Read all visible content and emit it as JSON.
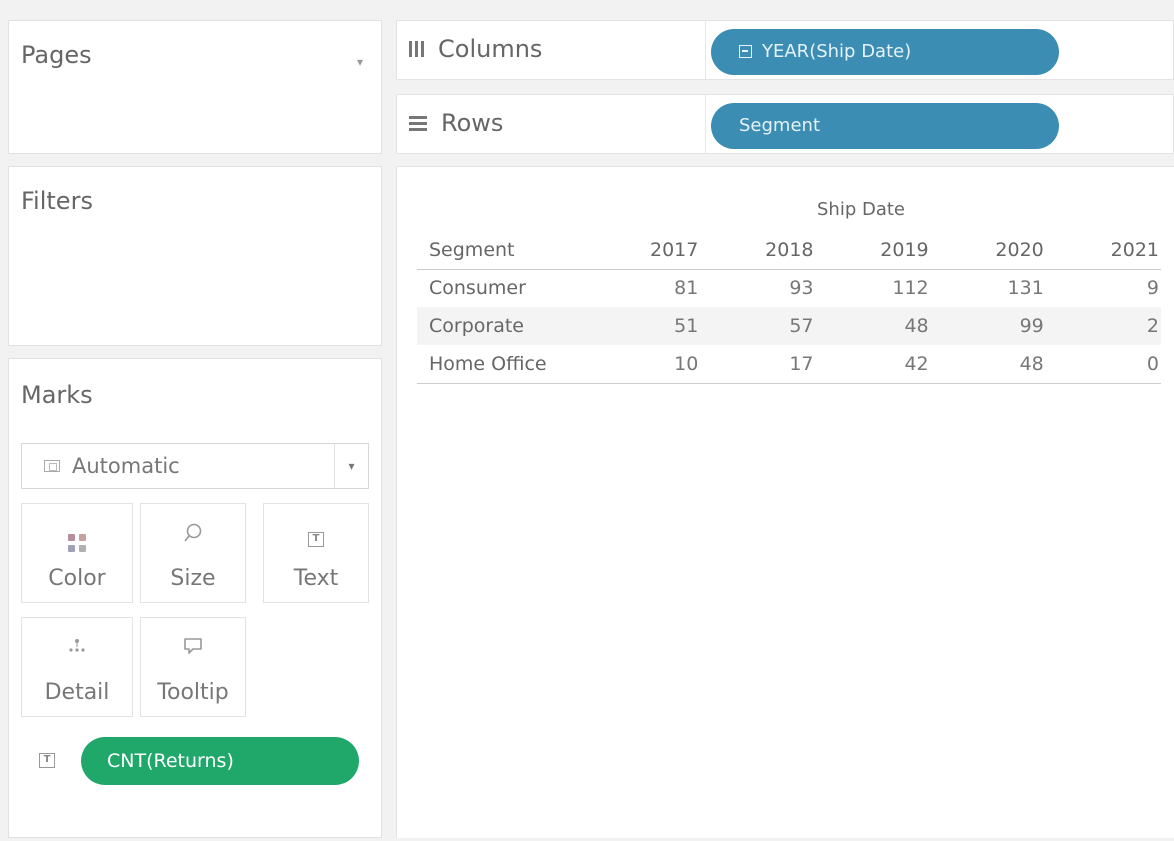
{
  "left_panel": {
    "pages": {
      "title": "Pages",
      "dropdown_icon": "chevron-down-icon"
    },
    "filters": {
      "title": "Filters"
    },
    "marks": {
      "title": "Marks",
      "mark_type": {
        "value": "Automatic",
        "icon": "automatic-mark-icon",
        "caret_icon": "caret-down-icon"
      },
      "buttons": [
        {
          "label": "Color",
          "icon": "color-icon"
        },
        {
          "label": "Size",
          "icon": "size-icon"
        },
        {
          "label": "Text",
          "icon": "text-icon"
        },
        {
          "label": "Detail",
          "icon": "detail-icon"
        },
        {
          "label": "Tooltip",
          "icon": "tooltip-icon"
        }
      ],
      "pills": [
        {
          "label": "CNT(Returns)",
          "type_icon": "text-icon",
          "color": "#1fa86a"
        }
      ]
    }
  },
  "shelves": {
    "columns": {
      "label": "Columns",
      "icon": "columns-icon",
      "pills": [
        {
          "label": "YEAR(Ship Date)",
          "icon": "date-icon",
          "color": "#3b8db3"
        }
      ]
    },
    "rows": {
      "label": "Rows",
      "icon": "rows-icon",
      "pills": [
        {
          "label": "Segment",
          "color": "#3b8db3"
        }
      ]
    }
  },
  "view": {
    "column_field": "Ship Date",
    "row_header": "Segment",
    "years": [
      "2017",
      "2018",
      "2019",
      "2020",
      "2021"
    ],
    "rows": [
      {
        "segment": "Consumer",
        "values": [
          "81",
          "93",
          "112",
          "131",
          "9"
        ]
      },
      {
        "segment": "Corporate",
        "values": [
          "51",
          "57",
          "48",
          "99",
          "2"
        ]
      },
      {
        "segment": "Home Office",
        "values": [
          "10",
          "17",
          "42",
          "48",
          "0"
        ]
      }
    ]
  },
  "colors": {
    "measure_pill": "#1fa86a",
    "dimension_pill": "#3b8db3",
    "background": "#f2f2f2"
  }
}
